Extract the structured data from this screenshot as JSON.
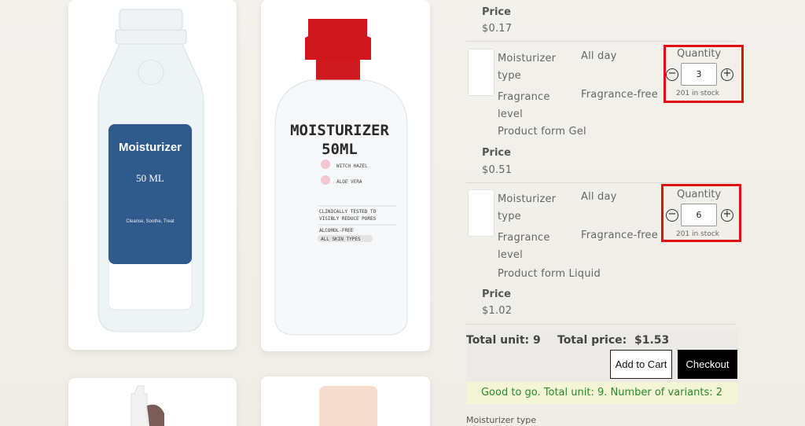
{
  "products_grid": {
    "card1": {
      "label_title": "Moisturizer",
      "label_volume": "50 ML",
      "label_desc": "Cleanse, Soothe, Treat"
    },
    "card2": {
      "title_line1": "MOISTURIZER",
      "title_line2": "50ML",
      "ingredient1": "WITCH HAZEL",
      "ingredient2": "ALOE VERA",
      "claim_line1": "CLINICALLY TESTED TO",
      "claim_line2": "VISIBLY REDUCE PORES",
      "feature1": "ALCOHOL-FREE",
      "feature2": "ALL SKIN TYPES"
    }
  },
  "top_price": {
    "label": "Price",
    "value": "$0.17"
  },
  "variants": [
    {
      "moisturizer_type_label": "Moisturizer type",
      "moisturizer_type_value": "All day",
      "fragrance_label": "Fragrance level",
      "fragrance_value": "Fragrance-free",
      "product_form": "Product form Gel",
      "price_label": "Price",
      "price_value": "$0.51",
      "quantity_title": "Quantity",
      "quantity_value": "3",
      "stock_text": "201 in stock"
    },
    {
      "moisturizer_type_label": "Moisturizer type",
      "moisturizer_type_value": "All day",
      "fragrance_label": "Fragrance level",
      "fragrance_value": "Fragrance-free",
      "product_form": "Product form Liquid",
      "price_label": "Price",
      "price_value": "$1.02",
      "quantity_title": "Quantity",
      "quantity_value": "6",
      "stock_text": "201 in stock"
    }
  ],
  "summary": {
    "total_unit": "Total unit: 9",
    "total_price": "Total price:  $1.53",
    "add_to_cart": "Add to Cart",
    "checkout": "Checkout",
    "status": "Good to go. Total unit: 9. Number of variants: 2"
  },
  "filter": {
    "label": "Moisturizer type"
  },
  "colors": {
    "highlight": "#e01010",
    "label_blue": "#2f5a8c",
    "cap_red": "#d0161e",
    "status_green": "#2a8a2a",
    "status_bg": "#f4f4d6"
  },
  "icons": [
    "minus-circle-icon",
    "plus-circle-icon"
  ]
}
